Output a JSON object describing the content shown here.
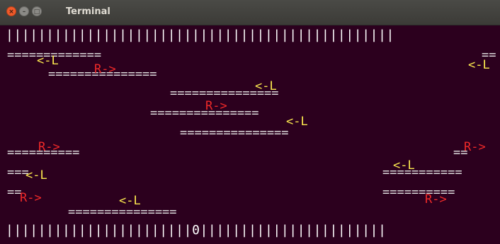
{
  "window": {
    "title": "Terminal",
    "close_glyph": "×",
    "minimize_glyph": "–",
    "maximize_glyph": "□"
  },
  "game": {
    "top_wall": "||||||||||||||||||||||||||||||||||||||||||||||||",
    "bottom_wall_left": "|||||||||||||||||||||||",
    "player": "0",
    "bottom_wall_right": "|||||||||||||||||||||||",
    "logs": [
      "=============",
      "==",
      "===============",
      "===============",
      "===============",
      "===============",
      "==========",
      "==",
      "===",
      "===========",
      "==",
      "==========",
      "===============",
      "====",
      "==",
      "======"
    ],
    "cars": [
      "<-L",
      "<-L",
      "R->",
      "<-L",
      "R->",
      "<-L",
      "R->",
      "R->",
      "<-L",
      "<-L",
      "R->",
      "R->",
      "<-L"
    ]
  },
  "colors": {
    "background": "#2c001e",
    "left_car": "#fce94f",
    "right_car": "#ef2929",
    "walls": "#ffffff"
  }
}
